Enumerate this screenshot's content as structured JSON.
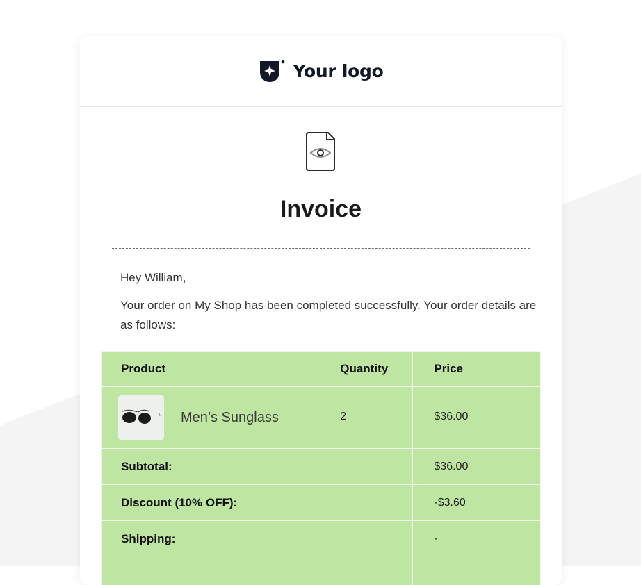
{
  "header": {
    "logo_text": "Your logo"
  },
  "invoice": {
    "title": "Invoice",
    "icon": "document-eye-icon",
    "greeting": "Hey William,",
    "message": "Your order on My Shop has been completed successfully. Your order details are as follows:"
  },
  "table": {
    "headers": {
      "product": "Product",
      "quantity": "Quantity",
      "price": "Price"
    },
    "items": [
      {
        "name": "Men’s Sunglass",
        "image_icon": "sunglasses-icon",
        "quantity": "2",
        "price": "$36.00"
      }
    ],
    "summary": [
      {
        "label": "Subtotal:",
        "value": "$36.00"
      },
      {
        "label": "Discount (10% OFF):",
        "value": "-$3.60"
      },
      {
        "label": "Shipping:",
        "value": "-"
      },
      {
        "label": "",
        "value": ""
      }
    ]
  },
  "colors": {
    "table_background": "#bfe5a3",
    "logo_color": "#111827",
    "background_wedge": "#f4f4f4"
  }
}
